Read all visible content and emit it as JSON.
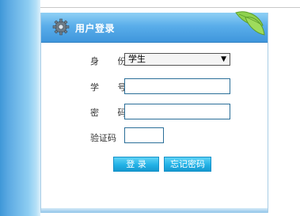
{
  "panel": {
    "title": "用户登录",
    "icon": "gear-icon",
    "decoration": "leaf-icon",
    "header_color": "#4fa5e6"
  },
  "form": {
    "identity": {
      "label": "身 份",
      "selected": "学生"
    },
    "student_id": {
      "label": "学 号",
      "value": ""
    },
    "password": {
      "label": "密 码",
      "value": ""
    },
    "captcha": {
      "label": "验证码",
      "value": ""
    }
  },
  "buttons": {
    "login": "登 录",
    "forgot": "忘记密码"
  },
  "colors": {
    "button": "#23b2e6",
    "input_border": "#2b6f99"
  }
}
